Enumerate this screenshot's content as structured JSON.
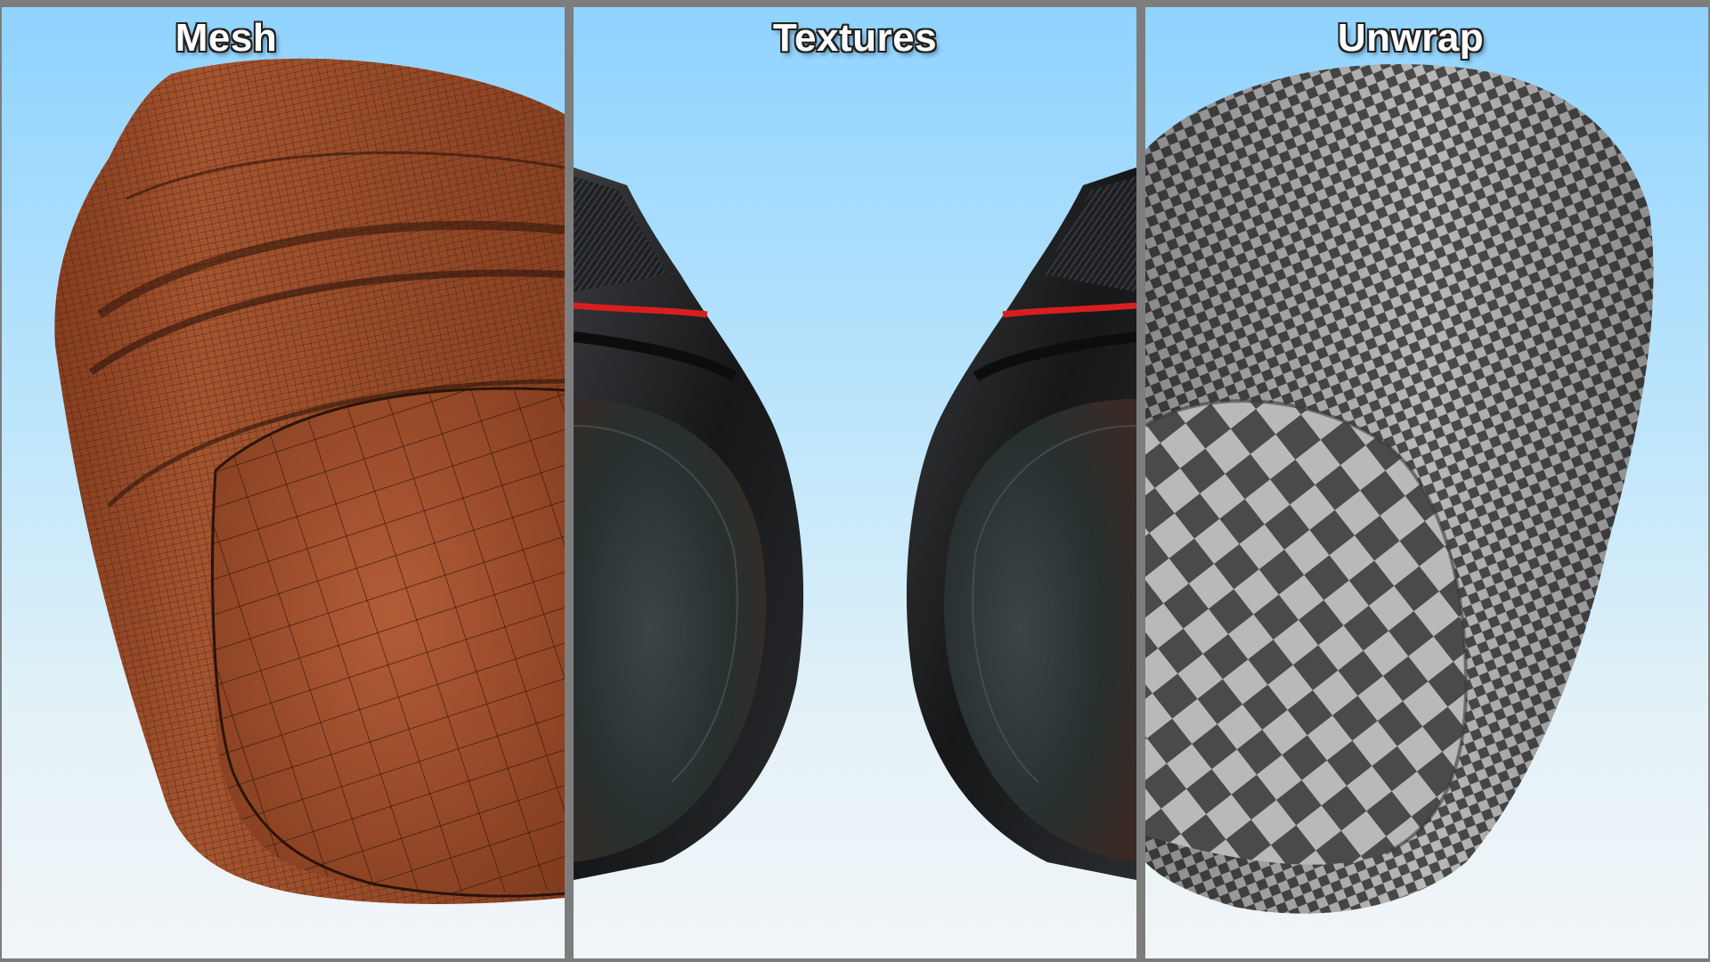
{
  "panels": [
    {
      "title": "Mesh"
    },
    {
      "title": "Textures"
    },
    {
      "title": "Unwrap"
    }
  ],
  "colors": {
    "frame": "#7d7d7d",
    "mesh_fill": "#9a4a2c",
    "lens_body": "#1c1d1f",
    "accent_ring": "#d81f1f",
    "checker_dark": "#4a4a4a",
    "checker_light": "#b9b9b9"
  }
}
